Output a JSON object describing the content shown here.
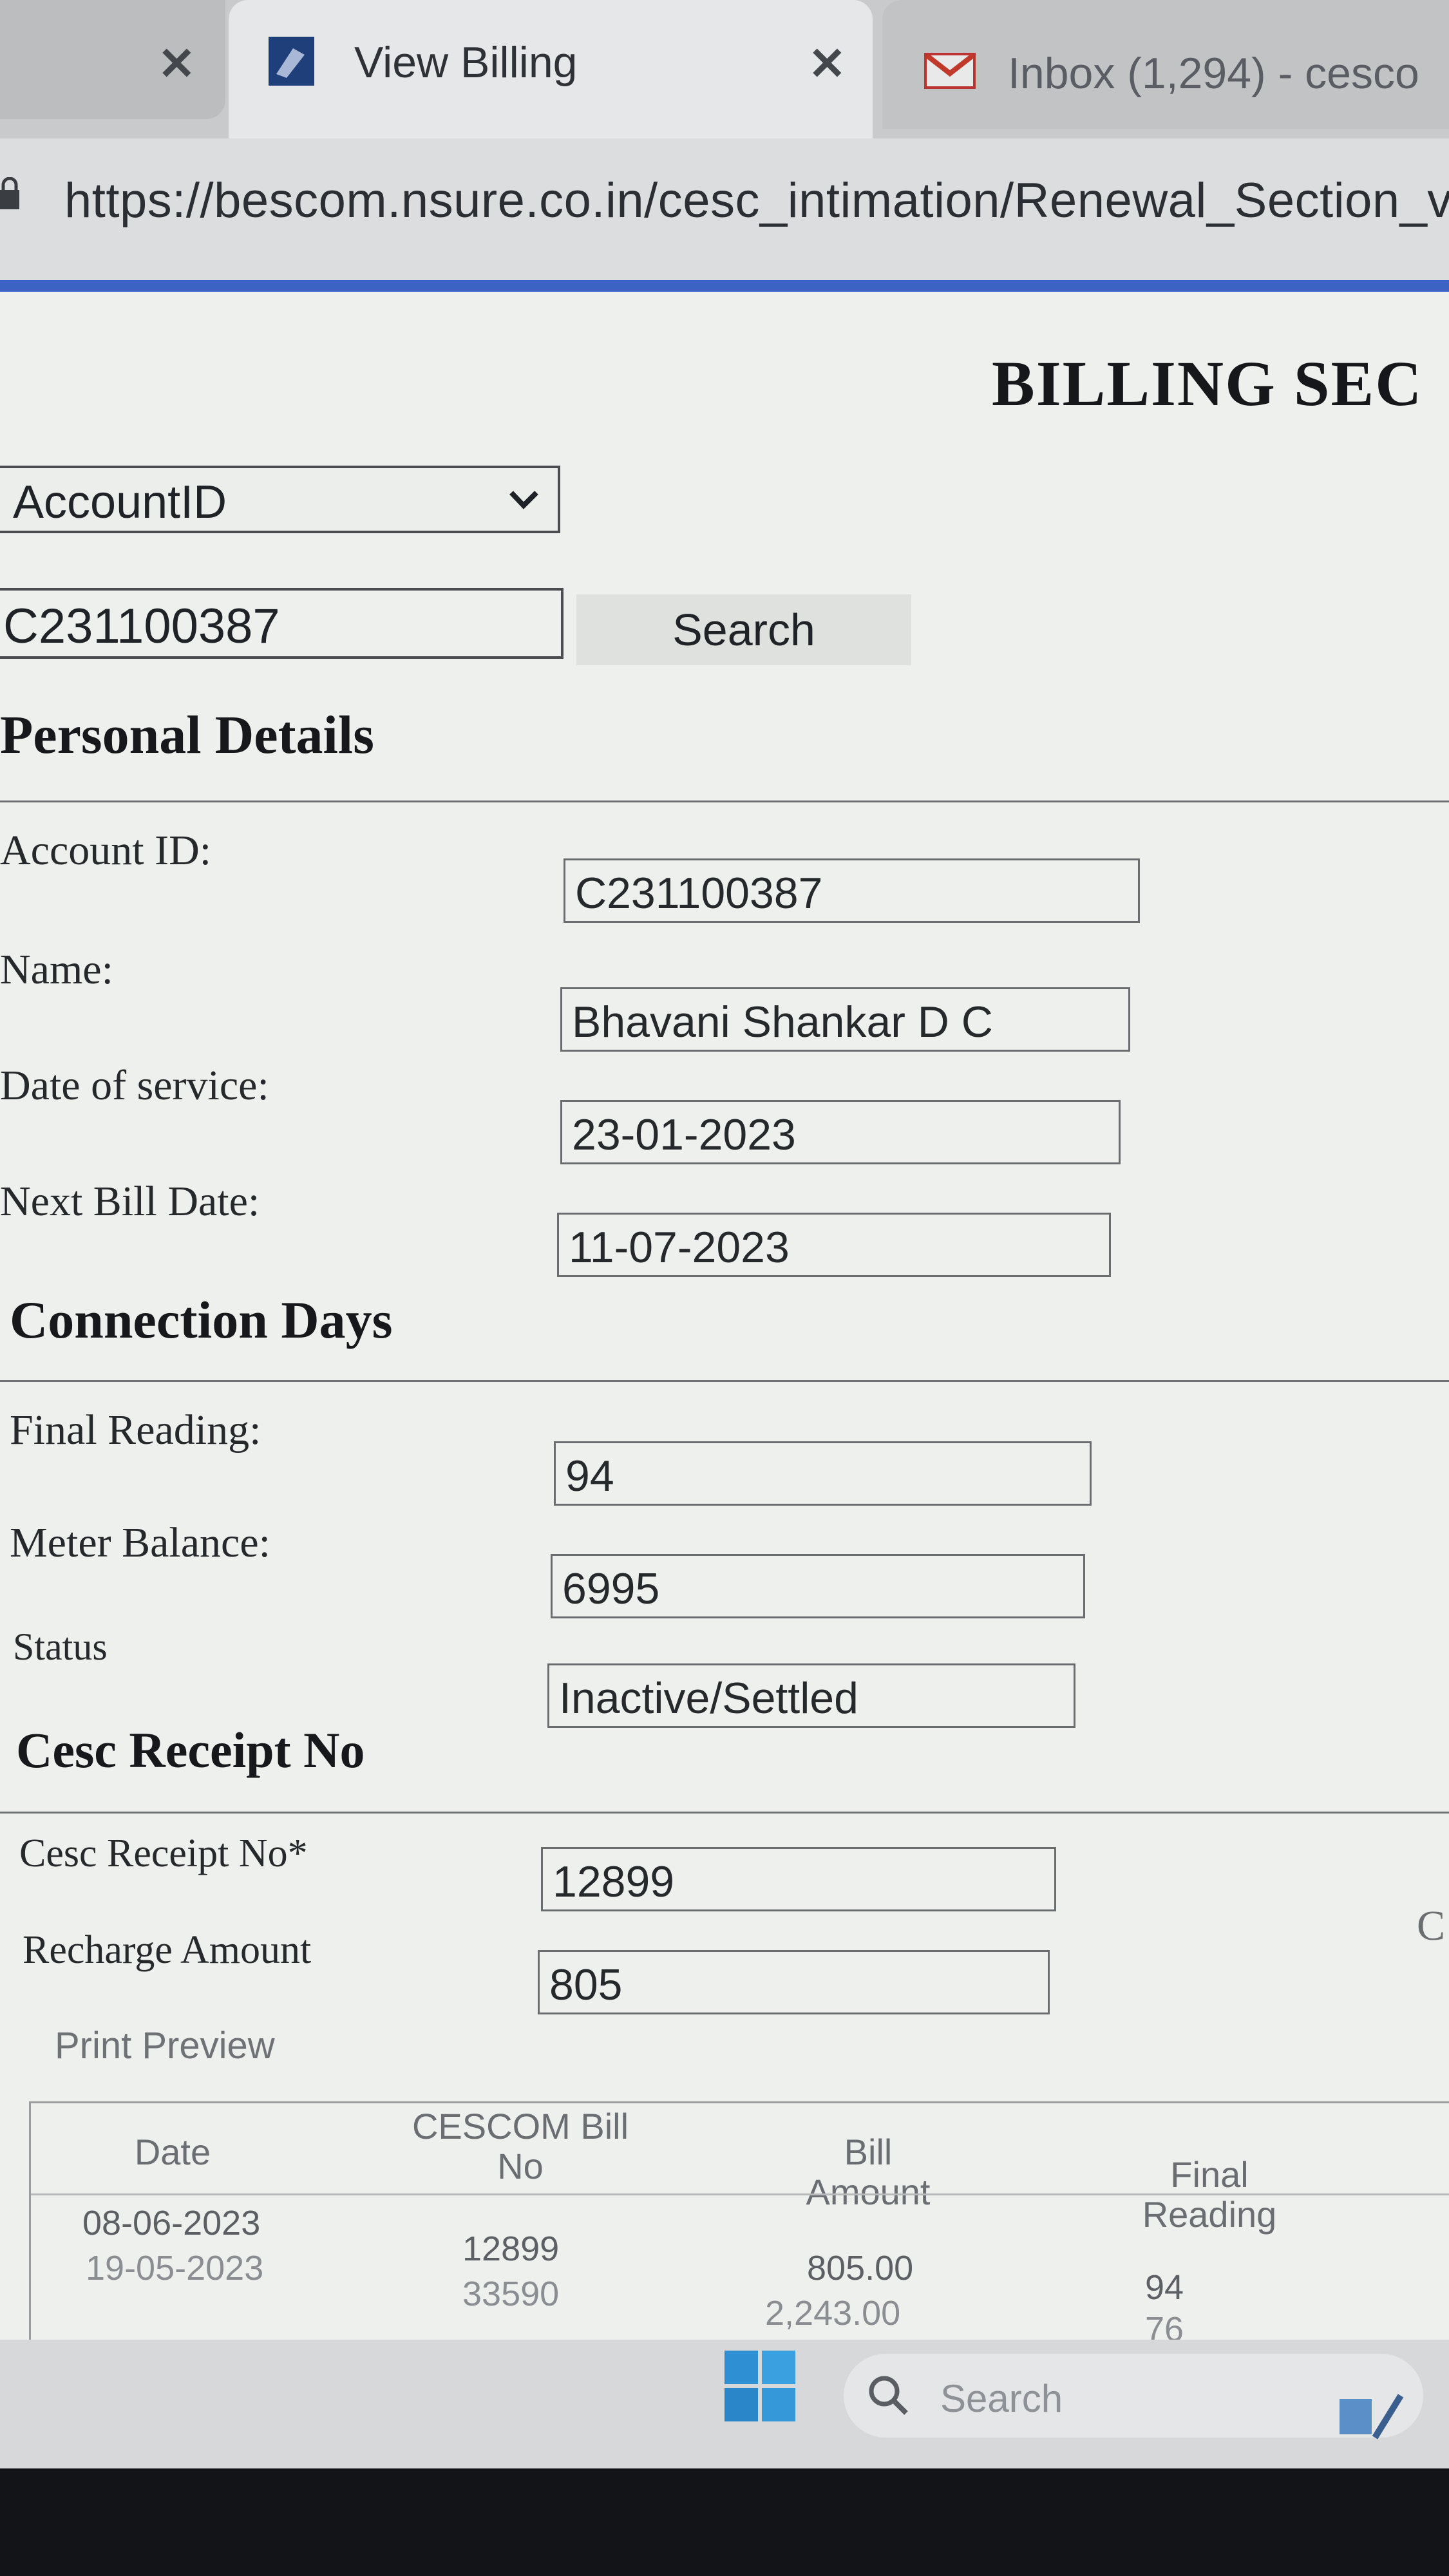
{
  "browser": {
    "tabs": [
      {
        "title": "View Billing",
        "icon": "document-icon",
        "active": true
      },
      {
        "title": "Inbox (1,294) - cesco",
        "icon": "gmail-icon",
        "active": false
      }
    ],
    "close_glyph": "✕",
    "url": "https://bescom.nsure.co.in/cesc_intimation/Renewal_Section_vi"
  },
  "page": {
    "title": "BILLING SEC",
    "search": {
      "field_select": "AccountID",
      "query": "C231100387",
      "button_label": "Search"
    },
    "personal_details": {
      "heading": "Personal Details",
      "fields": [
        {
          "label": "Account ID:",
          "value": "C231100387"
        },
        {
          "label": "Name:",
          "value": "Bhavani Shankar D C"
        },
        {
          "label": "Date of service:",
          "value": "23-01-2023"
        },
        {
          "label": "Next Bill Date:",
          "value": "11-07-2023"
        }
      ]
    },
    "connection_days": {
      "heading": "Connection Days",
      "fields": [
        {
          "label": "Final Reading:",
          "value": "94"
        },
        {
          "label": "Meter Balance:",
          "value": "6995"
        },
        {
          "label": "Status",
          "value": "Inactive/Settled"
        }
      ]
    },
    "receipt": {
      "heading": "Cesc Receipt No",
      "fields": [
        {
          "label": "Cesc Receipt No*",
          "value": "12899"
        },
        {
          "label": "Recharge Amount",
          "value": "805"
        }
      ],
      "truncated_right": "C",
      "print_preview": "Print Preview"
    },
    "billing_table": {
      "columns": [
        "Date",
        "CESCOM Bill\nNo",
        "Bill\nAmount",
        "Final\nReading"
      ],
      "rows": [
        {
          "date": "08-06-2023",
          "bill_no": "12899",
          "amount": "805.00",
          "reading": "94"
        },
        {
          "date": "19-05-2023",
          "bill_no": "33590",
          "amount": "2,243.00",
          "reading": "76"
        }
      ]
    }
  },
  "taskbar": {
    "search_placeholder": "Search"
  }
}
